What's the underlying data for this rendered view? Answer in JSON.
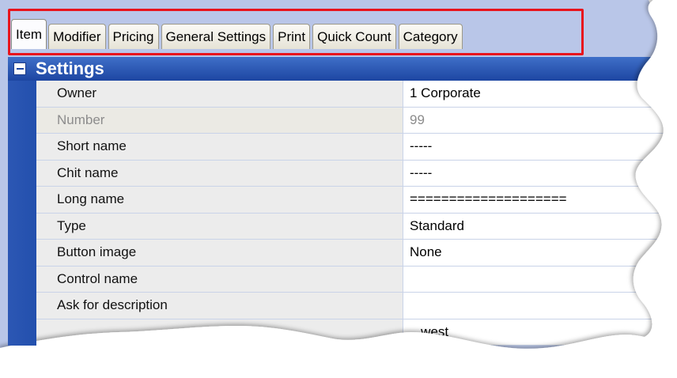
{
  "tabs": [
    {
      "label": "Item",
      "active": true
    },
    {
      "label": "Modifier",
      "active": false
    },
    {
      "label": "Pricing",
      "active": false
    },
    {
      "label": "General Settings",
      "active": false
    },
    {
      "label": "Print",
      "active": false
    },
    {
      "label": "Quick Count",
      "active": false
    },
    {
      "label": "Category",
      "active": false
    }
  ],
  "section": {
    "title": "Settings",
    "collapse_icon": "minus-icon"
  },
  "rows": [
    {
      "name": "Owner",
      "value": "1  Corporate"
    },
    {
      "name": "Number",
      "value": "99",
      "disabled": true
    },
    {
      "name": "Short name",
      "value": "-----"
    },
    {
      "name": "Chit name",
      "value": "-----"
    },
    {
      "name": "Long name",
      "value": "===================="
    },
    {
      "name": "Type",
      "value": "Standard"
    },
    {
      "name": "Button image",
      "value": "None"
    },
    {
      "name": "Control name",
      "value": ""
    },
    {
      "name": "Ask for description",
      "value": ""
    },
    {
      "name": "",
      "value": "...west"
    }
  ],
  "colors": {
    "highlight": "#e8141c",
    "header_blue": "#1d46a2",
    "torn_edge_fill": "#ffffff"
  }
}
